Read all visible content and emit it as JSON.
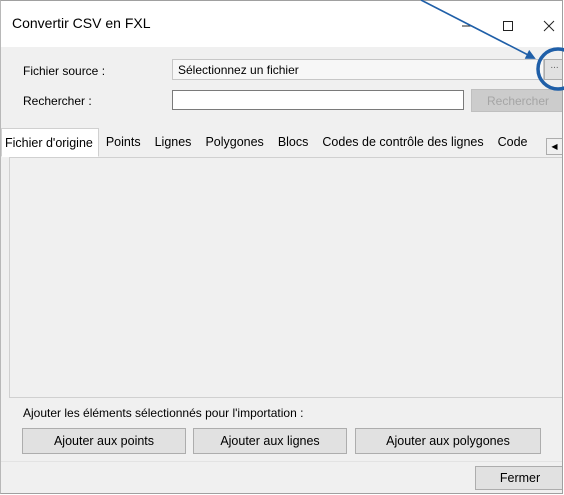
{
  "window": {
    "title": "Convertir CSV en FXL",
    "minimize_glyph": "—",
    "close_glyph": "✕"
  },
  "form": {
    "source_label": "Fichier source :",
    "source_value": "Sélectionnez un fichier",
    "browse_label": "...",
    "search_label": "Rechercher :",
    "search_value": "",
    "search_button": "Rechercher"
  },
  "tabs": [
    {
      "label": "Fichier d'origine",
      "active": true
    },
    {
      "label": "Points"
    },
    {
      "label": "Lignes"
    },
    {
      "label": "Polygones"
    },
    {
      "label": "Blocs"
    },
    {
      "label": "Codes de contrôle des lignes"
    },
    {
      "label": "Code"
    }
  ],
  "tab_scroll_glyph": "◀",
  "import": {
    "label": "Ajouter les éléments sélectionnés pour l'importation :",
    "add_points": "Ajouter aux points",
    "add_lines": "Ajouter aux lignes",
    "add_polygons": "Ajouter aux polygones"
  },
  "footer": {
    "close_button": "Fermer"
  },
  "colors": {
    "annotation": "#1f5fa8",
    "window_bg": "#f0f0f0",
    "button_bg": "#e1e1e1"
  }
}
